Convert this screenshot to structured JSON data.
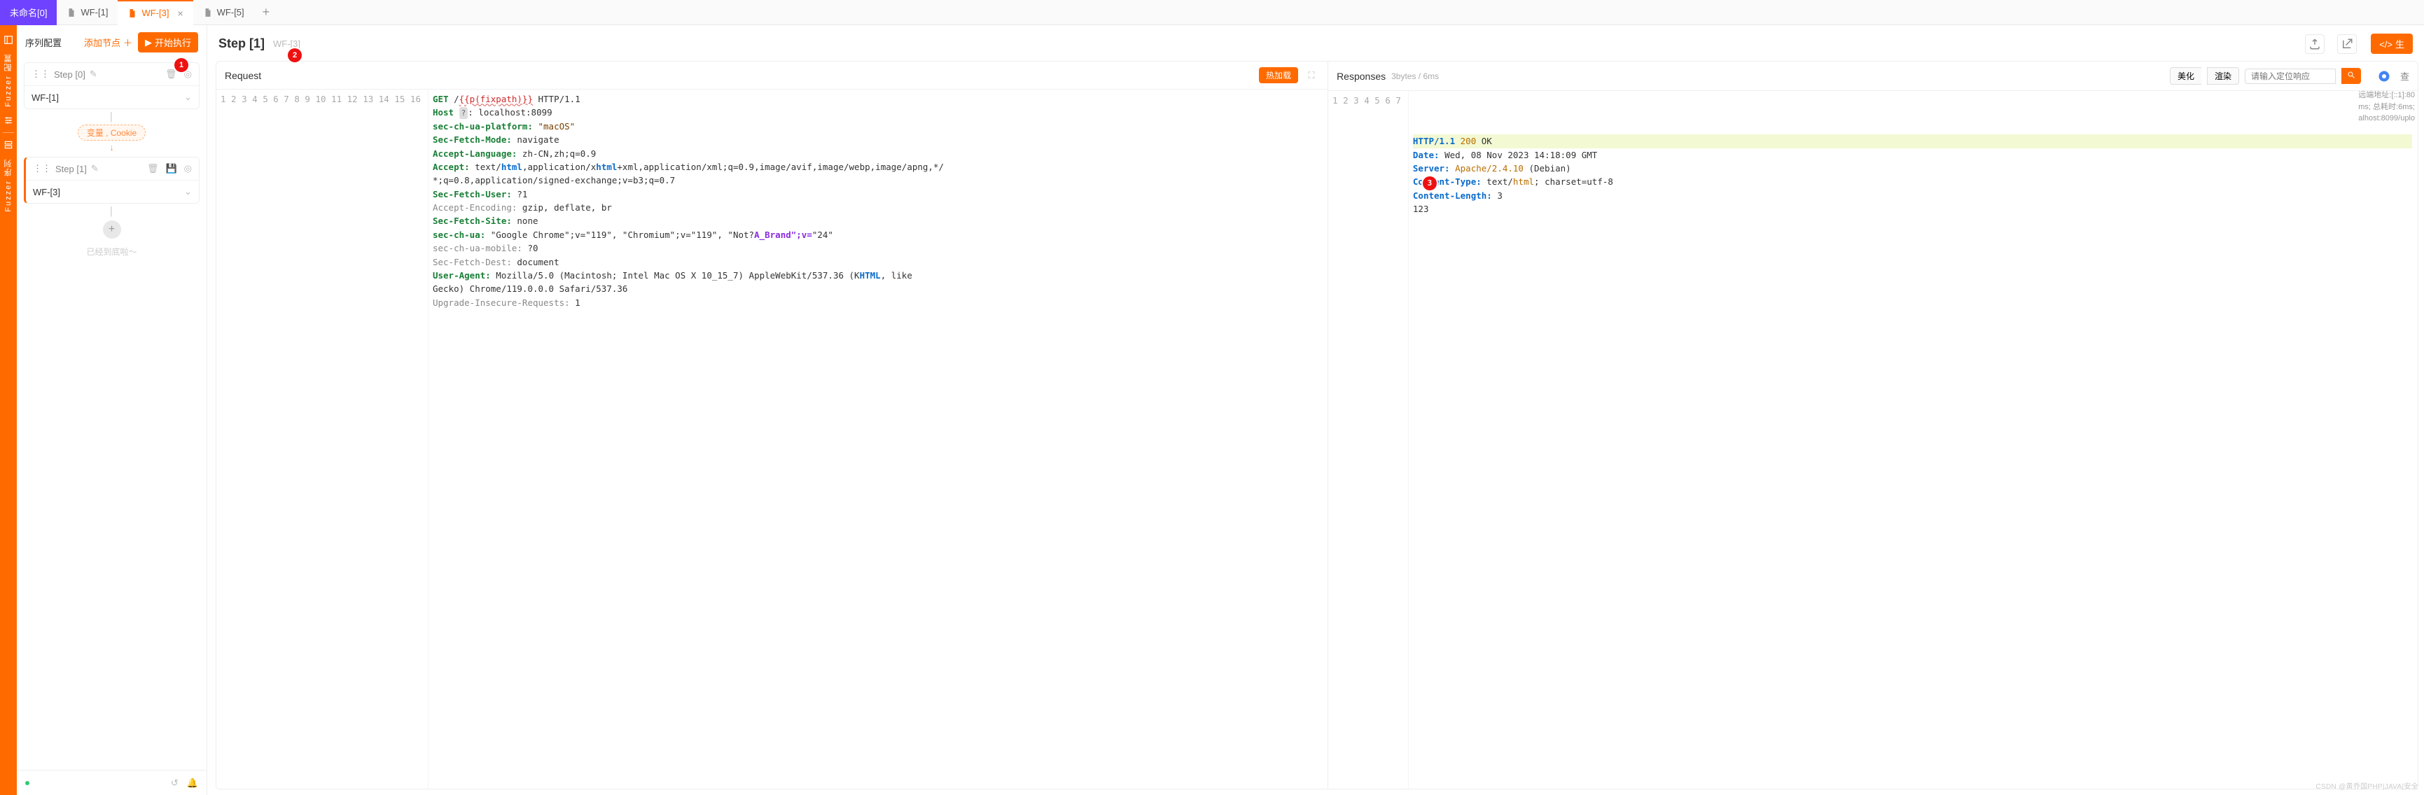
{
  "tabs": {
    "primary": "未命名[0]",
    "items": [
      {
        "label": "WF-[1]",
        "active": false
      },
      {
        "label": "WF-[3]",
        "active": true
      },
      {
        "label": "WF-[5]",
        "active": false
      }
    ]
  },
  "vside": {
    "block1": "Fuzzer 配置",
    "block2": "Fuzzer 序列"
  },
  "leftpane": {
    "title": "序列配置",
    "add_label": "添加节点",
    "run_label": "开始执行",
    "link_label": "变量 , Cookie",
    "end_label": "已经到底啦～",
    "steps": [
      {
        "step": "Step [0]",
        "value": "WF-[1]"
      },
      {
        "step": "Step [1]",
        "value": "WF-[3]"
      }
    ]
  },
  "head": {
    "step": "Step [1]",
    "crumb": "WF-[3]",
    "gen_label": "生"
  },
  "request": {
    "title": "Request",
    "hot": "热加载",
    "lines": [
      {
        "n": 1,
        "segs": [
          {
            "t": "GET ",
            "c": "tk-method"
          },
          {
            "t": "/",
            "c": ""
          },
          {
            "t": "{{p(fixpath)}}",
            "c": "tk-path"
          },
          {
            "t": " HTTP/1.1",
            "c": ""
          }
        ]
      },
      {
        "n": 2,
        "segs": [
          {
            "t": "Host",
            "c": "tk-hdr"
          },
          {
            "t": " ",
            "c": ""
          },
          {
            "t": "?",
            "c": "badge-q"
          },
          {
            "t": ": localhost:8099",
            "c": ""
          }
        ]
      },
      {
        "n": 3,
        "segs": [
          {
            "t": "sec-ch-ua-platform:",
            "c": "tk-hdr"
          },
          {
            "t": " \"macOS\"",
            "c": "tk-str"
          }
        ]
      },
      {
        "n": 4,
        "segs": [
          {
            "t": "Sec-Fetch-Mode:",
            "c": "tk-hdr"
          },
          {
            "t": " navigate",
            "c": ""
          }
        ]
      },
      {
        "n": 5,
        "segs": [
          {
            "t": "Accept-Language:",
            "c": "tk-hdr"
          },
          {
            "t": " zh-CN,zh;q=0.9",
            "c": ""
          }
        ]
      },
      {
        "n": 6,
        "segs": [
          {
            "t": "Accept:",
            "c": "tk-hdr"
          },
          {
            "t": " text/",
            "c": ""
          },
          {
            "t": "html",
            "c": "tk-hdr2"
          },
          {
            "t": ",application/x",
            "c": ""
          },
          {
            "t": "html",
            "c": "tk-hdr2"
          },
          {
            "t": "+xml,application/xml;q=0.9,image/avif,image/webp,image/apng,*/",
            "c": ""
          }
        ]
      },
      {
        "n": 0,
        "segs": [
          {
            "t": "*;q=0.8,application/signed-exchange;v=b3;q=0.7",
            "c": ""
          }
        ]
      },
      {
        "n": 7,
        "segs": [
          {
            "t": "Sec-Fetch-User:",
            "c": "tk-hdr"
          },
          {
            "t": " ?1",
            "c": ""
          }
        ]
      },
      {
        "n": 8,
        "segs": [
          {
            "t": "Accept-Encoding:",
            "c": "tk-grey"
          },
          {
            "t": " gzip, deflate, br",
            "c": ""
          }
        ]
      },
      {
        "n": 9,
        "segs": [
          {
            "t": "Sec-Fetch-Site:",
            "c": "tk-hdr"
          },
          {
            "t": " none",
            "c": ""
          }
        ]
      },
      {
        "n": 10,
        "segs": [
          {
            "t": "sec-ch-ua:",
            "c": "tk-hdr"
          },
          {
            "t": " \"Google Chrome\";v=\"119\", \"Chromium\";v=\"119\", \"Not?",
            "c": ""
          },
          {
            "t": "A_Brand\";v=",
            "c": "tk-purple"
          },
          {
            "t": "\"24\"",
            "c": ""
          }
        ]
      },
      {
        "n": 11,
        "segs": [
          {
            "t": "sec-ch-ua-mobile:",
            "c": "tk-grey"
          },
          {
            "t": " ?0",
            "c": ""
          }
        ]
      },
      {
        "n": 12,
        "segs": [
          {
            "t": "Sec-Fetch-Dest:",
            "c": "tk-grey"
          },
          {
            "t": " document",
            "c": ""
          }
        ]
      },
      {
        "n": 13,
        "segs": [
          {
            "t": "User-Agent:",
            "c": "tk-hdr"
          },
          {
            "t": " Mozilla/5.0 (Macintosh; Intel Mac OS X 10_15_7) AppleWebKit/537.36 (K",
            "c": ""
          },
          {
            "t": "HTML",
            "c": "tk-hdr2"
          },
          {
            "t": ", like ",
            "c": ""
          }
        ]
      },
      {
        "n": 0,
        "segs": [
          {
            "t": "Gecko) Chrome/119.0.0.0 Safari/537.36",
            "c": ""
          }
        ]
      },
      {
        "n": 14,
        "segs": [
          {
            "t": "Upgrade-Insecure-Requests:",
            "c": "tk-grey"
          },
          {
            "t": " 1",
            "c": ""
          }
        ]
      },
      {
        "n": 15,
        "segs": []
      },
      {
        "n": 16,
        "segs": []
      }
    ]
  },
  "response": {
    "title": "Responses",
    "meta": "3bytes / 6ms",
    "beautify": "美化",
    "render": "渲染",
    "search_ph": "请输入定位响应",
    "other": "查",
    "sideinfo": [
      "远端地址:[::1]:80",
      "ms; 总耗时:6ms;",
      "alhost:8099/uplo"
    ],
    "lines": [
      {
        "n": 1,
        "hl": true,
        "segs": [
          {
            "t": "HTTP/1.1 ",
            "c": "tk-hdr2"
          },
          {
            "t": "200 ",
            "c": "tk-num"
          },
          {
            "t": "OK",
            "c": ""
          }
        ]
      },
      {
        "n": 2,
        "segs": [
          {
            "t": "Date:",
            "c": "tk-hdr2"
          },
          {
            "t": " Wed, 08 Nov 2023 14:18:09 GMT",
            "c": ""
          }
        ]
      },
      {
        "n": 3,
        "segs": [
          {
            "t": "Server:",
            "c": "tk-hdr2"
          },
          {
            "t": " Apache/2.4.10 ",
            "c": "tk-num"
          },
          {
            "t": "(Debian)",
            "c": ""
          }
        ]
      },
      {
        "n": 4,
        "segs": [
          {
            "t": "Content-Type:",
            "c": "tk-hdr2"
          },
          {
            "t": " text/",
            "c": ""
          },
          {
            "t": "html",
            "c": "tk-num"
          },
          {
            "t": "; charset=utf-8",
            "c": ""
          }
        ]
      },
      {
        "n": 5,
        "segs": [
          {
            "t": "Content-Length:",
            "c": "tk-hdr2"
          },
          {
            "t": " 3",
            "c": ""
          }
        ]
      },
      {
        "n": 6,
        "segs": []
      },
      {
        "n": 7,
        "segs": [
          {
            "t": "123",
            "c": ""
          }
        ]
      }
    ]
  },
  "callouts": {
    "c1": "1",
    "c2": "2",
    "c3": "3"
  },
  "watermark": "CSDN @黄乔国PHP|JAVA|安全"
}
